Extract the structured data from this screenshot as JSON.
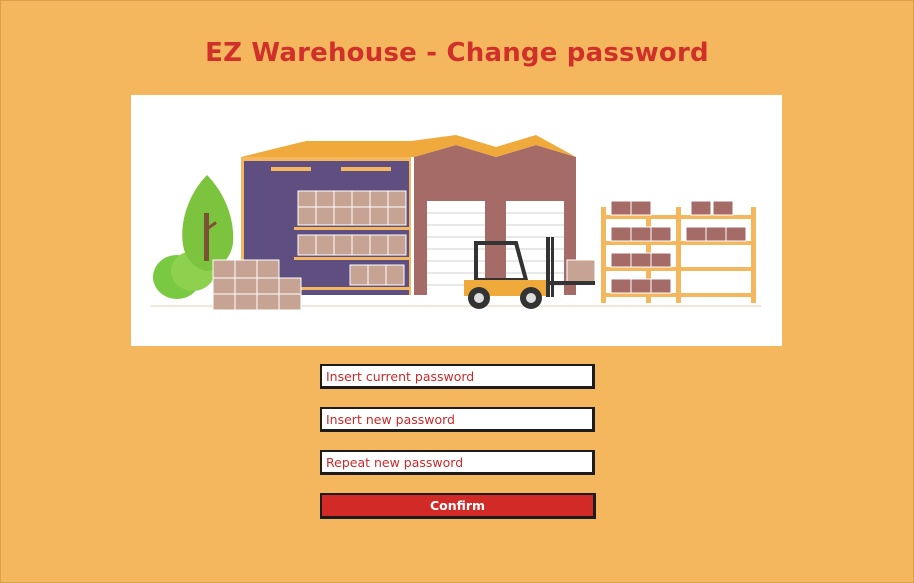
{
  "page": {
    "title": "EZ Warehouse - Change password"
  },
  "hero": {
    "icon": "warehouse-illustration"
  },
  "form": {
    "current_password_placeholder": "Insert current password",
    "new_password_placeholder": "Insert new password",
    "repeat_password_placeholder": "Repeat new password",
    "confirm_label": "Confirm"
  },
  "colors": {
    "background": "#f4b75e",
    "title": "#d12f2a",
    "button": "#d12a27",
    "field_text": "#c92a2a"
  }
}
